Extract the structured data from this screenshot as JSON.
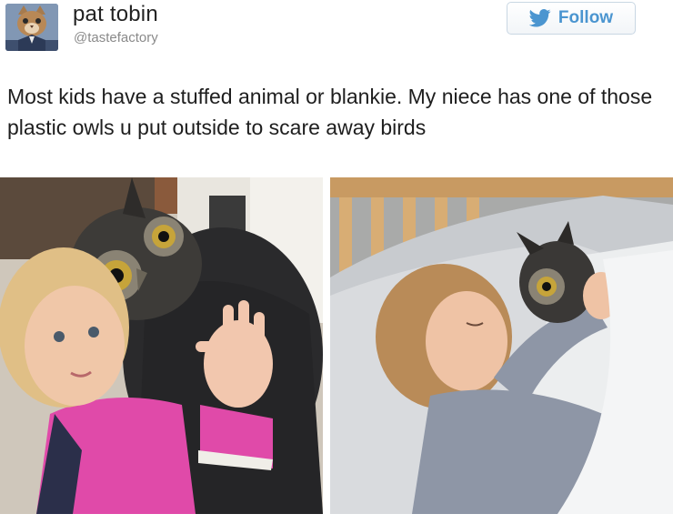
{
  "tweet": {
    "author": {
      "display_name": "pat tobin",
      "handle": "@tastefactory",
      "avatar_icon": "cat-avatar"
    },
    "follow_button": {
      "label": "Follow",
      "icon": "twitter-bird-icon",
      "accent_color": "#4b95d0"
    },
    "text": "Most kids have a stuffed animal or blankie. My niece has one of those plastic owls u put outside to scare away birds",
    "photos": [
      {
        "content": "toddler-hugging-plastic-owl"
      },
      {
        "content": "toddler-sleeping-with-plastic-owl"
      }
    ]
  }
}
